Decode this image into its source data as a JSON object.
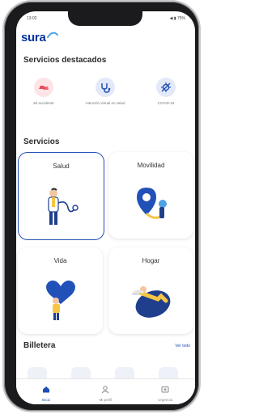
{
  "status": {
    "time": "13:02",
    "right": "◀ ▮ 75%"
  },
  "brand": {
    "name": "sura"
  },
  "featured": {
    "title": "Servicios destacados",
    "items": [
      {
        "label": "Mi accidente",
        "icon": "car-crash-icon",
        "color": "#e84b55"
      },
      {
        "label": "Atención virtual en salud",
        "icon": "stethoscope-icon",
        "color": "#2150b8"
      },
      {
        "label": "COVID-19",
        "icon": "virus-icon",
        "color": "#2150b8"
      }
    ]
  },
  "services": {
    "title": "Servicios",
    "items": [
      {
        "label": "Salud",
        "icon": "doctor-illustration"
      },
      {
        "label": "Movilidad",
        "icon": "location-pin-illustration"
      },
      {
        "label": "Vida",
        "icon": "heart-person-illustration"
      },
      {
        "label": "Hogar",
        "icon": "home-relax-illustration"
      }
    ]
  },
  "wallet": {
    "title": "Billetera",
    "link": "Ver todo"
  },
  "nav": [
    {
      "label": "Inicio",
      "icon": "home-icon",
      "active": true
    },
    {
      "label": "Mi perfil",
      "icon": "profile-icon",
      "active": false
    },
    {
      "label": "Urgencia",
      "icon": "emergency-icon",
      "active": false
    }
  ],
  "colors": {
    "brand": "#0033a0",
    "accent": "#2150b8",
    "alert": "#e84b55"
  }
}
